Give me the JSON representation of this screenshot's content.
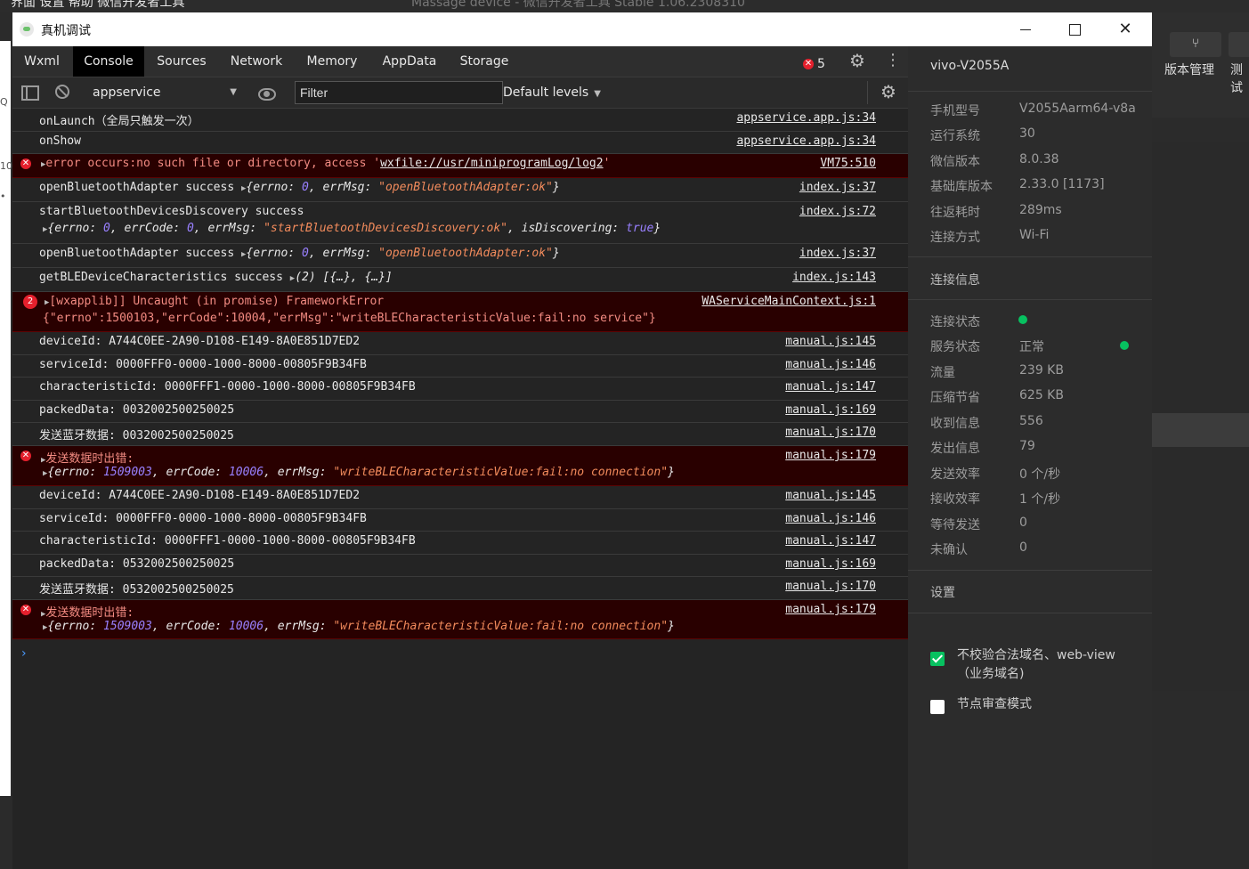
{
  "background": {
    "menu": "界面   设置   帮助   微信开发者工具",
    "title": "Massage device - 微信开发者工具 Stable 1.06.2308310",
    "right_buttons": [
      "版本管理",
      "测试"
    ],
    "left_edge": [
      "10",
      "•",
      "Q"
    ]
  },
  "window": {
    "title": "真机调试",
    "close_label": "✕"
  },
  "tabs": [
    "Wxml",
    "Console",
    "Sources",
    "Network",
    "Memory",
    "AppData",
    "Storage"
  ],
  "active_tab": "Console",
  "error_count": "5",
  "toolbar": {
    "context": "appservice",
    "filter_placeholder": "Filter",
    "levels": "Default levels"
  },
  "console": [
    {
      "type": "log",
      "msg": "onLaunch（全局只触发一次）",
      "src": "appservice.app.js:34"
    },
    {
      "type": "log",
      "msg": "onShow",
      "src": "appservice.app.js:34"
    },
    {
      "type": "error",
      "msg_prefix": "error occurs:no such file or directory, access '",
      "msg_link": "wxfile://usr/miniprogramLog/log2",
      "msg_suffix": "'",
      "src": "VM75:510"
    },
    {
      "type": "log",
      "msg": "openBluetoothAdapter success",
      "obj": "{errno: 0, errMsg: \"openBluetoothAdapter:ok\"}",
      "src": "index.js:37"
    },
    {
      "type": "log",
      "msg": "startBluetoothDevicesDiscovery success",
      "obj": "{errno: 0, errCode: 0, errMsg: \"startBluetoothDevicesDiscovery:ok\", isDiscovering: true}",
      "src": "index.js:72"
    },
    {
      "type": "log",
      "msg": "openBluetoothAdapter success",
      "obj": "{errno: 0, errMsg: \"openBluetoothAdapter:ok\"}",
      "src": "index.js:37"
    },
    {
      "type": "log",
      "msg": "getBLEDeviceCharacteristics success",
      "obj": "(2) [{…}, {…}]",
      "src": "index.js:143"
    },
    {
      "type": "error",
      "badge": "2",
      "msg": "[wxapplib]] Uncaught (in promise) FrameworkError",
      "line2": "{\"errno\":1500103,\"errCode\":10004,\"errMsg\":\"writeBLECharacteristicValue:fail:no service\"}",
      "src": "WAServiceMainContext.js:1"
    },
    {
      "type": "log",
      "msg": "deviceId: A744C0EE-2A90-D108-E149-8A0E851D7ED2",
      "src": "manual.js:145"
    },
    {
      "type": "log",
      "msg": "serviceId: 0000FFF0-0000-1000-8000-00805F9B34FB",
      "src": "manual.js:146"
    },
    {
      "type": "log",
      "msg": "characteristicId: 0000FFF1-0000-1000-8000-00805F9B34FB",
      "src": "manual.js:147"
    },
    {
      "type": "log",
      "msg": "packedData: 0032002500250025",
      "src": "manual.js:169"
    },
    {
      "type": "log",
      "msg": "发送蓝牙数据: 0032002500250025",
      "src": "manual.js:170"
    },
    {
      "type": "error",
      "msg": "发送数据时出错:",
      "obj": "{errno: 1509003, errCode: 10006, errMsg: \"writeBLECharacteristicValue:fail:no connection\"}",
      "src": "manual.js:179"
    },
    {
      "type": "log",
      "msg": "deviceId: A744C0EE-2A90-D108-E149-8A0E851D7ED2",
      "src": "manual.js:145"
    },
    {
      "type": "log",
      "msg": "serviceId: 0000FFF0-0000-1000-8000-00805F9B34FB",
      "src": "manual.js:146"
    },
    {
      "type": "log",
      "msg": "characteristicId: 0000FFF1-0000-1000-8000-00805F9B34FB",
      "src": "manual.js:147"
    },
    {
      "type": "log",
      "msg": "packedData: 0532002500250025",
      "src": "manual.js:169"
    },
    {
      "type": "log",
      "msg": "发送蓝牙数据: 0532002500250025",
      "src": "manual.js:170"
    },
    {
      "type": "error",
      "msg": "发送数据时出错:",
      "obj": "{errno: 1509003, errCode: 10006, errMsg: \"writeBLECharacteristicValue:fail:no connection\"}",
      "src": "manual.js:179"
    }
  ],
  "prompt": "›",
  "sidebar": {
    "device": "vivo-V2055A",
    "info": [
      {
        "k": "手机型号",
        "v": "V2055Aarm64-v8a"
      },
      {
        "k": "运行系统",
        "v": "30"
      },
      {
        "k": "微信版本",
        "v": "8.0.38"
      },
      {
        "k": "基础库版本",
        "v": "2.33.0 [1173]"
      },
      {
        "k": "往返耗时",
        "v": "289ms"
      },
      {
        "k": "连接方式",
        "v": "Wi-Fi"
      }
    ],
    "conn_title": "连接信息",
    "conn": [
      {
        "k": "连接状态",
        "v": ""
      },
      {
        "k": "服务状态",
        "v": "正常"
      },
      {
        "k": "流量",
        "v": "239 KB"
      },
      {
        "k": "压缩节省",
        "v": "625 KB"
      },
      {
        "k": "收到信息",
        "v": "556"
      },
      {
        "k": "发出信息",
        "v": "79"
      },
      {
        "k": "发送效率",
        "v": "0 个/秒"
      },
      {
        "k": "接收效率",
        "v": "1 个/秒"
      },
      {
        "k": "等待发送",
        "v": "0"
      },
      {
        "k": "未确认",
        "v": "0"
      }
    ],
    "status_color": "#07c160",
    "settings_title": "设置",
    "settings": [
      {
        "label": "不校验合法域名、web-view（业务域名)",
        "checked": true
      },
      {
        "label": "节点审查模式",
        "checked": false
      }
    ]
  }
}
